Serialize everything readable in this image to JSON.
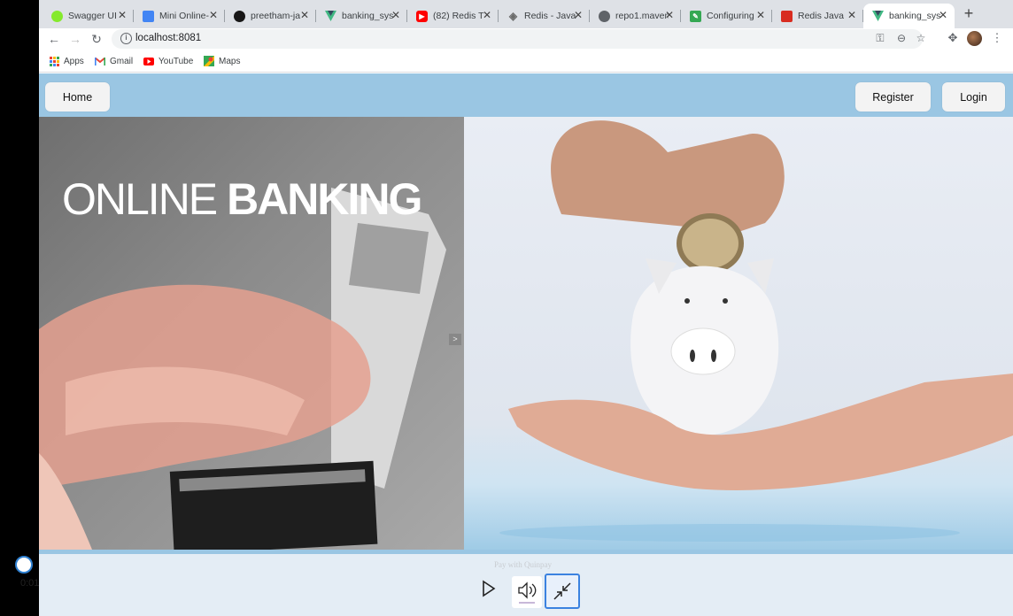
{
  "browser": {
    "tabs": [
      {
        "title": "Swagger UI",
        "icon": "swagger-icon",
        "color": "#85ea2d"
      },
      {
        "title": "Mini Online-",
        "icon": "docs-icon",
        "color": "#4285f4"
      },
      {
        "title": "preetham-ja",
        "icon": "github-icon",
        "color": "#181717"
      },
      {
        "title": "banking_sys",
        "icon": "vue-icon",
        "color": "#41b883"
      },
      {
        "title": "(82) Redis T",
        "icon": "youtube-icon",
        "color": "#ff0000"
      },
      {
        "title": "Redis - Java",
        "icon": "diamond-icon",
        "color": "#6b6b6b"
      },
      {
        "title": "repo1.maven",
        "icon": "globe-icon",
        "color": "#5f6368"
      },
      {
        "title": "Configuring",
        "icon": "edit-icon",
        "color": "#35a853"
      },
      {
        "title": "Redis Java",
        "icon": "redis-icon",
        "color": "#d82c20"
      },
      {
        "title": "banking_sys",
        "icon": "vue-icon",
        "color": "#41b883"
      }
    ],
    "new_tab": "+",
    "url": "localhost:8081",
    "bookmarks": [
      {
        "label": "Apps",
        "icon": "apps-grid-icon"
      },
      {
        "label": "Gmail",
        "icon": "gmail-icon"
      },
      {
        "label": "YouTube",
        "icon": "youtube-icon"
      },
      {
        "label": "Maps",
        "icon": "maps-icon"
      }
    ]
  },
  "page": {
    "nav": {
      "home": "Home",
      "register": "Register",
      "login": "Login"
    },
    "hero": {
      "title_thin": "ONLINE ",
      "title_bold": "BANKING",
      "arrow": ">"
    },
    "colors": {
      "navbar": "#9ac6e3",
      "button": "#f3f3f3"
    }
  },
  "player": {
    "timecode": "0:01",
    "pay_label": "Pay with Quinpay",
    "progress": 0.0
  }
}
